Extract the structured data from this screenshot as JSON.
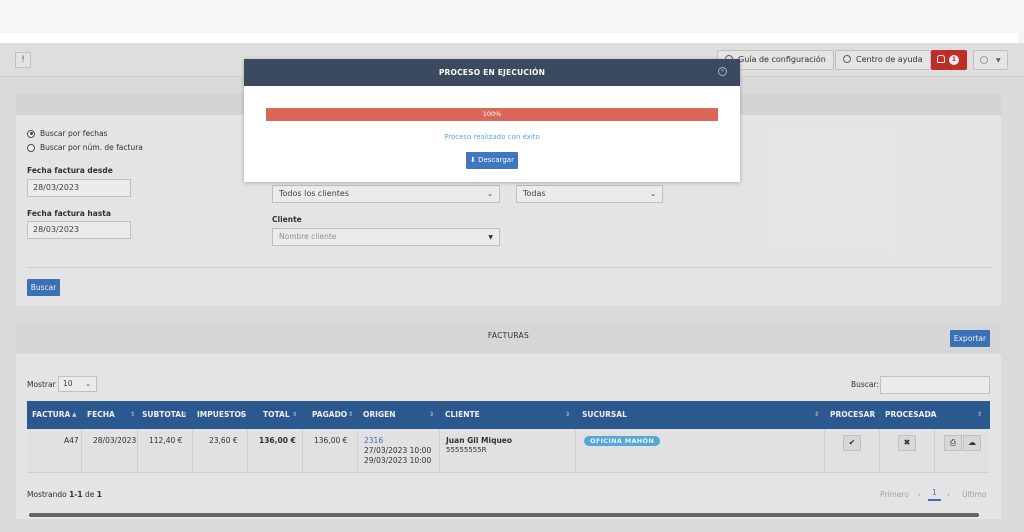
{
  "toolbar": {
    "left_btn": "!",
    "config_guide": "Guía de configuración",
    "help_center": "Centro de ayuda",
    "notifications_count": "1"
  },
  "filters": {
    "radio_dates": "Buscar por fechas",
    "radio_number": "Buscar por núm. de factura",
    "date_from_label": "Fecha factura desde",
    "date_from_value": "28/03/2023",
    "date_to_label": "Fecha factura hasta",
    "date_to_value": "28/03/2023",
    "clients_select": "Todos los clientes",
    "branch_select": "Todas",
    "client_label": "Cliente",
    "client_placeholder": "Nombre cliente",
    "search_button": "Buscar"
  },
  "invoices": {
    "title": "FACTURAS",
    "export_button": "Exportar",
    "show_label": "Mostrar",
    "show_value": "10",
    "search_label": "Buscar:",
    "columns": [
      "FACTURA",
      "FECHA",
      "SUBTOTAL",
      "IMPUESTOS",
      "TOTAL",
      "PAGADO",
      "ORIGEN",
      "CLIENTE",
      "SUCURSAL",
      "PROCESAR",
      "PROCESADA"
    ],
    "row": {
      "factura": "A47",
      "fecha": "28/03/2023",
      "subtotal": "112,40 €",
      "impuestos": "23,60 €",
      "total": "136,00 €",
      "pagado": "136,00 €",
      "origen_id": "2316",
      "origen_date1": "27/03/2023 10:00",
      "origen_date2": "29/03/2023 10:00",
      "cliente_name": "Juan Gil Miqueo",
      "cliente_id": "55555555R",
      "sucursal": "OFICINA MAHÓN",
      "procesar": "✔",
      "procesada": "✖"
    },
    "footer": {
      "showing_prefix": "Mostrando ",
      "showing_range": "1-1",
      "showing_mid": " de ",
      "showing_total": "1"
    },
    "pager": {
      "first": "Primero",
      "prev": "‹",
      "current": "1",
      "next": "›",
      "last": "Último"
    }
  },
  "modal": {
    "title": "PROCESO EN EJECUCIÓN",
    "progress": 100,
    "progress_label": "100%",
    "message": "Proceso realizado con éxito",
    "download_button": "⬇ Descargar"
  },
  "colors": {
    "primary": "#3f78c0",
    "table_header": "#2e5f98",
    "modal_header": "#3b4a5e",
    "progress": "#d9675a",
    "danger": "#c9302c",
    "pill": "#5ab2e6"
  }
}
